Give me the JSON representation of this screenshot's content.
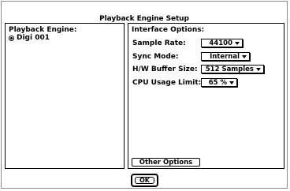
{
  "dialog": {
    "title": "Playback Engine Setup"
  },
  "playback_engine": {
    "heading": "Playback Engine:",
    "selected": "Digi 001"
  },
  "interface_options": {
    "heading": "Interface Options:",
    "rows": [
      {
        "label": "Sample Rate:",
        "value": "44100"
      },
      {
        "label": "Sync Mode:",
        "value": "Internal"
      },
      {
        "label": "H/W Buffer Size:",
        "value": "512 Samples"
      },
      {
        "label": "CPU Usage Limit:",
        "value": "65 %"
      }
    ],
    "other_options_label": "Other Options"
  },
  "buttons": {
    "ok_label": "OK"
  }
}
